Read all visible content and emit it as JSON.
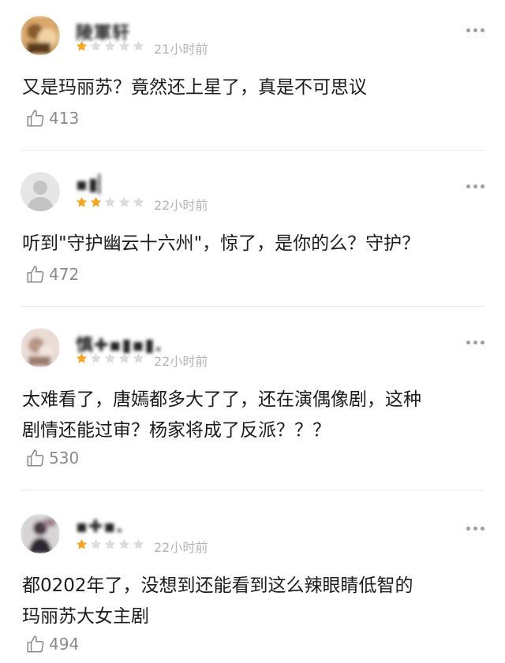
{
  "colors": {
    "star_filled": "#f5a623",
    "star_empty": "#dcdcdc",
    "meta_text": "#b5b5b5",
    "like_text": "#8a8a8a"
  },
  "comments": [
    {
      "username": "陵軍轩",
      "rating": 1,
      "time": "21小时前",
      "lines": [
        "又是玛丽苏？竟然还上星了，真是不可思议"
      ],
      "likes": "413"
    },
    {
      "username": "▪▮▏",
      "rating": 2,
      "time": "22小时前",
      "lines": [
        "听到\"守护幽云十六州\"，惊了，是你的么？守护？"
      ],
      "likes": "472"
    },
    {
      "username": "慎✚▪▮▪▮.",
      "rating": 1,
      "time": "22小时前",
      "lines": [
        "太难看了，唐嫣都多大了了，还在演偶像剧，这种",
        "剧情还能过审？杨家将成了反派？？？"
      ],
      "likes": "530"
    },
    {
      "username": "▪✚▪.",
      "rating": 1,
      "time": "22小时前",
      "lines": [
        "都0202年了，没想到还能看到这么辣眼睛低智的",
        "玛丽苏大女主剧"
      ],
      "likes": "494"
    }
  ]
}
